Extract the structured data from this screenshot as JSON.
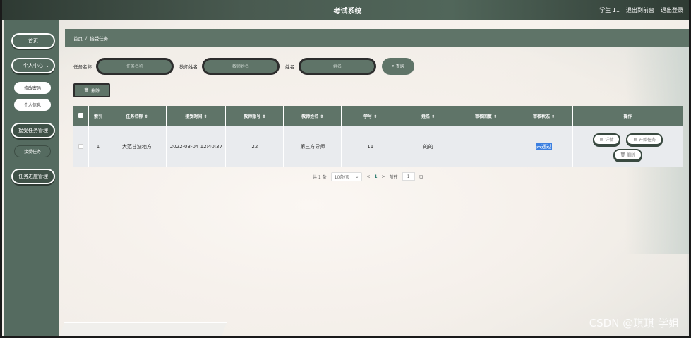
{
  "header": {
    "title": "考试系统",
    "user": "学生 11",
    "back_label": "退出到前台",
    "logout_label": "退出登录"
  },
  "sidebar": {
    "home": "首页",
    "personal_center": "个人中心",
    "change_password": "修改密码",
    "personal_info": "个人信息",
    "accept_task_mgmt": "接受任务管理",
    "accept_task": "接受任务",
    "task_progress_mgmt": "任务进度管理"
  },
  "breadcrumb": {
    "home": "首页",
    "sep": "/",
    "current": "接受任务"
  },
  "search": {
    "task_name_label": "任务名称",
    "task_name_placeholder": "任务名称",
    "teacher_name_label": "教师姓名",
    "teacher_name_placeholder": "教师姓名",
    "name_label": "姓名",
    "name_placeholder": "姓名",
    "query_label": "查询"
  },
  "actions": {
    "delete_label": "删除"
  },
  "table": {
    "headers": [
      "索引",
      "任务名称 ⇕",
      "接受时间 ⇕",
      "教师账号 ⇕",
      "教师姓名 ⇕",
      "学号 ⇕",
      "姓名 ⇕",
      "审核回复 ⇕",
      "审核状态 ⇕",
      "操作"
    ],
    "rows": [
      {
        "index": "1",
        "task_name": "大范甘迪地方",
        "accept_time": "2022-03-04 12:40:37",
        "teacher_account": "22",
        "teacher_name": "第三方导师",
        "student_no": "11",
        "name": "的的",
        "review_reply": "",
        "review_status": "未通过",
        "op_detail": "详情",
        "op_start": "开始任务",
        "op_delete": "删除"
      }
    ]
  },
  "pager": {
    "total": "共 1 条",
    "page_size": "10条/页",
    "prev": "<",
    "current_page": "1",
    "next": ">",
    "goto_label": "前往",
    "goto_value": "1",
    "page_unit": "页"
  },
  "watermark": "CSDN @琪琪 学姐",
  "colors": {
    "accent": "#5f7468",
    "topbar": "#2e3a33",
    "selection": "#3b7fe0"
  },
  "icons": {
    "search": "search-icon",
    "delete": "trash-icon",
    "detail": "document-icon",
    "start": "document-icon"
  }
}
